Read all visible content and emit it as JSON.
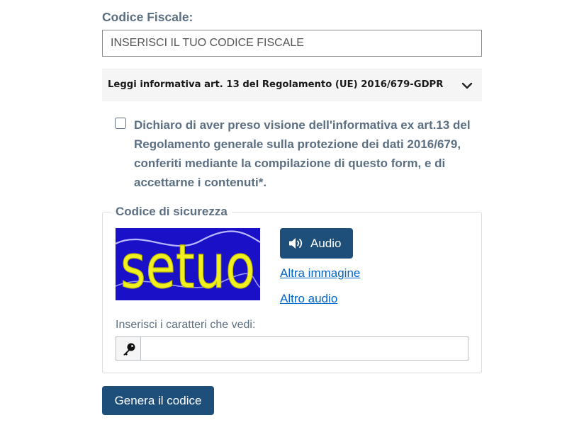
{
  "form": {
    "codice_fiscale_label": "Codice Fiscale:",
    "codice_fiscale_placeholder": "INSERISCI IL TUO CODICE FISCALE",
    "codice_fiscale_value": ""
  },
  "privacy": {
    "accordion_title": "Leggi informativa art. 13 del Regolamento (UE) 2016/679-GDPR",
    "consent_text": "Dichiaro di aver preso visione dell'informativa ex art.13 del Regolamento generale sulla protezione dei dati 2016/679, conferiti mediante la compilazione di questo form, e di accettarne i contenuti*.",
    "consent_checked": false
  },
  "captcha": {
    "legend": "Codice di sicurezza",
    "image_text": "setuo",
    "audio_button": "Audio",
    "other_image_link": "Altra immagine",
    "other_audio_link": "Altro audio",
    "input_hint": "Inserisci i caratteri che vedi:",
    "input_value": ""
  },
  "actions": {
    "submit_label": "Genera il codice"
  },
  "colors": {
    "primary": "#1e4e7a",
    "label_text": "#5c6f82",
    "link": "#0066cc",
    "captcha_bg": "#1a10c8",
    "captcha_text": "#f0f020"
  },
  "icons": {
    "accordion": "chevron-down-icon",
    "audio": "speaker-icon",
    "key": "key-icon"
  }
}
